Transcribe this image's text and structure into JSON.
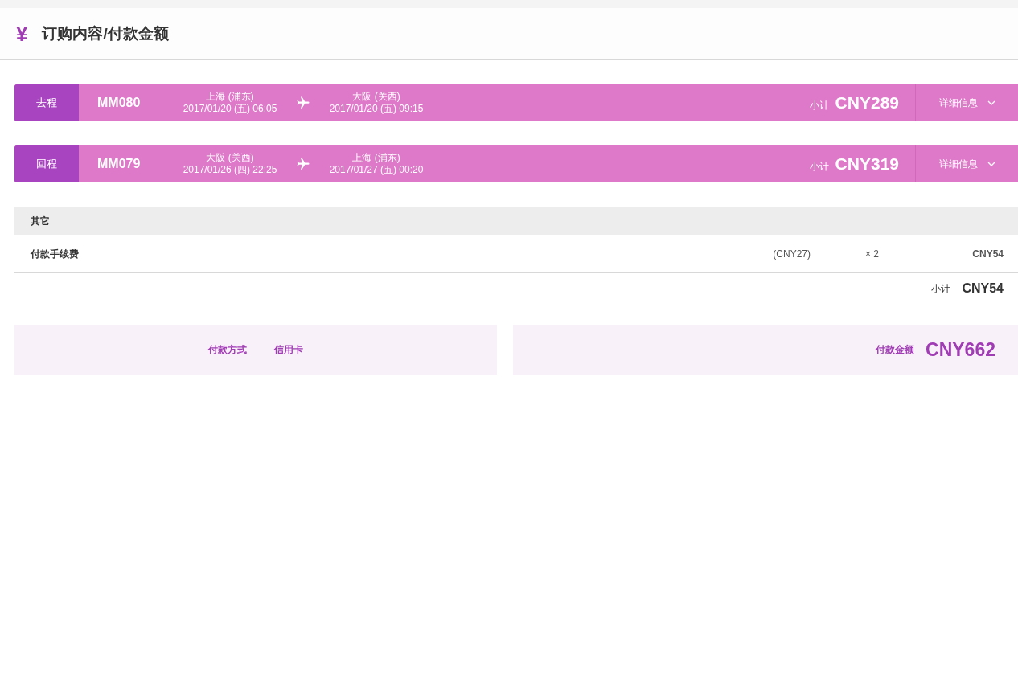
{
  "header": {
    "icon": "¥",
    "title": "订购内容/付款金额"
  },
  "flights": [
    {
      "direction": "去程",
      "flight_no": "MM080",
      "from": {
        "place": "上海 (浦东)",
        "time": "2017/01/20 (五) 06:05"
      },
      "to": {
        "place": "大阪 (关西)",
        "time": "2017/01/20 (五) 09:15"
      },
      "subtotal_label": "小计",
      "subtotal": "CNY289",
      "details": "详细信息",
      "expanded": false
    },
    {
      "direction": "回程",
      "flight_no": "MM079",
      "from": {
        "place": "大阪 (关西)",
        "time": "2017/01/26 (四) 22:25"
      },
      "to": {
        "place": "上海 (浦东)",
        "time": "2017/01/27 (五) 00:20"
      },
      "subtotal_label": "小计",
      "subtotal": "CNY319",
      "details": "详细信息",
      "expanded": false
    }
  ],
  "other": {
    "heading": "其它",
    "rows": [
      {
        "name": "付款手续费",
        "unit_price": "(CNY27)",
        "quantity": "× 2",
        "amount": "CNY54"
      }
    ],
    "subtotal_label": "小计",
    "subtotal": "CNY54"
  },
  "payment": {
    "method_label": "付款方式",
    "method": "信用卡",
    "total_label": "付款金额",
    "total": "CNY662"
  }
}
